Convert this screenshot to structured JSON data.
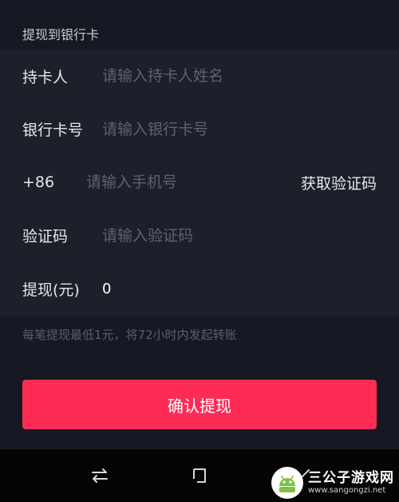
{
  "header": {
    "title": "提现到银行卡"
  },
  "form": {
    "cardholder": {
      "label": "持卡人",
      "placeholder": "请输入持卡人姓名"
    },
    "card_number": {
      "label": "银行卡号",
      "placeholder": "请输入银行卡号"
    },
    "phone": {
      "prefix": "+86",
      "placeholder": "请输入手机号",
      "get_code_label": "获取验证码"
    },
    "verification": {
      "label": "验证码",
      "placeholder": "请输入验证码"
    },
    "amount": {
      "label": "提现(元)",
      "value": "0"
    }
  },
  "hint": "每笔提现最低1元，将72小时内发起转账",
  "confirm_button": {
    "label": "确认提现"
  },
  "colors": {
    "accent": "#fe2c55",
    "background": "#161823",
    "panel": "#1d1f2b"
  },
  "watermark": {
    "title": "三公子游戏网",
    "url": "www.sangongzi.net"
  }
}
